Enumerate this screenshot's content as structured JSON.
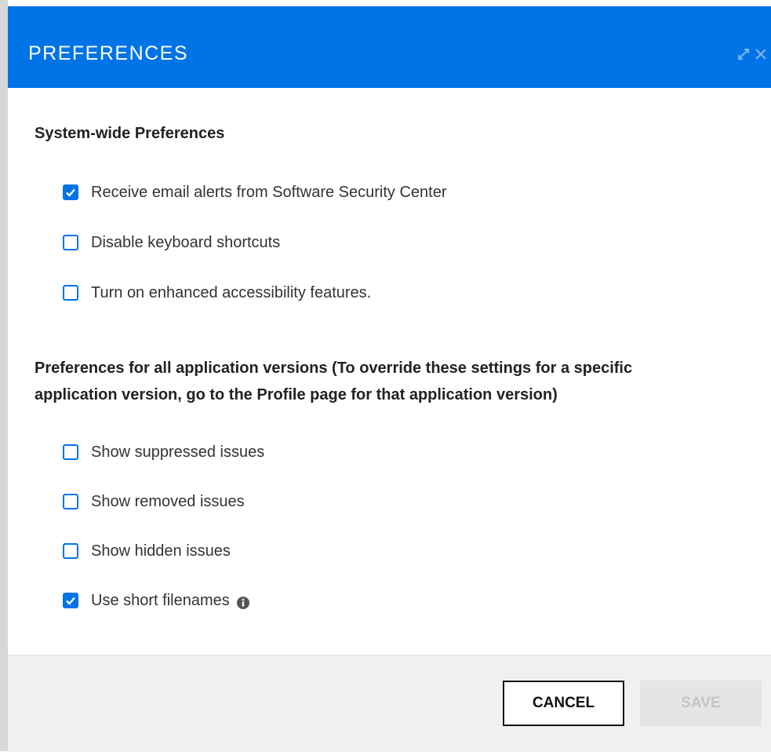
{
  "dialog": {
    "title": "PREFERENCES"
  },
  "header_icons": {
    "expand": "expand-icon",
    "close": "close-icon"
  },
  "system_section": {
    "title": "System-wide Preferences",
    "options": [
      {
        "label": "Receive email alerts from Software Security Center",
        "checked": true
      },
      {
        "label": "Disable keyboard shortcuts",
        "checked": false
      },
      {
        "label": "Turn on enhanced accessibility features.",
        "checked": false
      }
    ]
  },
  "app_section": {
    "title_line1": "Preferences for all application versions (To override these settings for a specific",
    "title_line2": "application version, go to the Profile page for that application version)",
    "options": [
      {
        "label": "Show suppressed issues",
        "checked": false
      },
      {
        "label": "Show removed issues",
        "checked": false
      },
      {
        "label": "Show hidden issues",
        "checked": false
      },
      {
        "label": "Use short filenames",
        "checked": true,
        "info_icon": "info-icon"
      }
    ]
  },
  "footer": {
    "cancel_label": "CANCEL",
    "save_label": "SAVE"
  },
  "colors": {
    "header": "#0073e7",
    "accent": "#0073e7",
    "footer_bg": "#f0f0f0",
    "save_disabled": "#e5e5e5"
  }
}
